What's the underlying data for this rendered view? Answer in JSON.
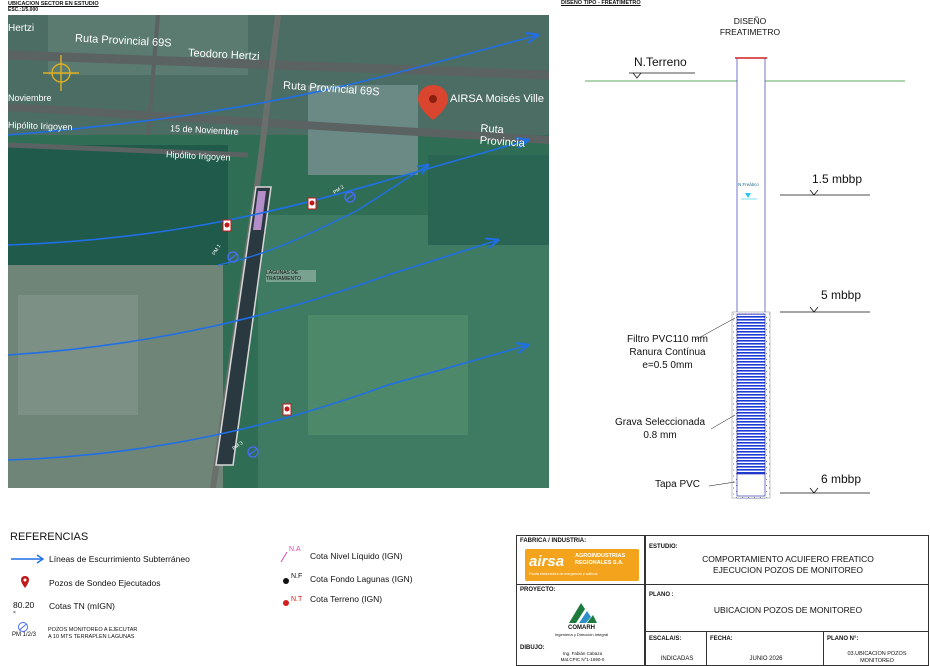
{
  "map": {
    "title": "UBICACION SECTOR EN ESTUDIO",
    "scale": "ESC.:1/5.000",
    "roads": {
      "rp69s_top": "Ruta Provincial 69S",
      "teodoro_top": "Teodoro Hertzi",
      "hertzi_left": "Hertzi",
      "rp69s_mid": "Ruta Provincial 69S",
      "noviembre_left": "Noviembre",
      "noviembre_mid": "15 de Noviembre",
      "irigoyen_left": "Hipólito Irigoyen",
      "irigoyen_mid": "Hipólito Irigoyen",
      "rp_right": "Ruta Provincia"
    },
    "place_label": "AIRSA Moisés Ville",
    "lagunas_label": "LAGUNAS DE TRATAMIENTO",
    "pm_labels": [
      "PM 1",
      "PM 2",
      "PM 3"
    ],
    "colors": {
      "flow": "#1e6fe8",
      "field": "#2f6e55",
      "road": "#5b6262"
    }
  },
  "section": {
    "title": "DISEÑO TIPO - FREATIMETRO",
    "heading_line1": "DISEÑO",
    "heading_line2": "FREATIMETRO",
    "ground": "N.Terreno",
    "freatico": "N.Freático",
    "level1": "1.5 mbbp",
    "level2": "5 mbbp",
    "level3": "6 mbbp",
    "filtro1": "Filtro PVC110 mm",
    "filtro2": "Ranura Contínua",
    "filtro3": "e=0.5 0mm",
    "grava1": "Grava Seleccionada",
    "grava2": "0.8 mm",
    "tapa": "Tapa PVC"
  },
  "references": {
    "title": "REFERENCIAS",
    "flow": "Líneas de Escurrimiento Subterráneo",
    "pozos": "Pozos de Sondeo Ejecutados",
    "cotas_num": "80.20",
    "cotas": "Cotas TN (mIGN)",
    "pm_symbol": "PM 1/2/3",
    "pm_line1": "POZOS MONITOREO A EJECUTAR",
    "pm_line2": "A 10 MTS TERRAPLEN LAGUNAS",
    "na_tag": "N.A",
    "na": "Cota Nivel Líquido (IGN)",
    "nf_tag": "N.F",
    "nf": "Cota Fondo Lagunas (IGN)",
    "nt_tag": "N.T",
    "nt": "Cota Terreno (IGN)"
  },
  "titleblock": {
    "fabrica_label": "FABRICA / INDUSTRIA:",
    "airsa_brand": "airsa",
    "airsa_name1": "AGROINDUSTRIAS",
    "airsa_name2": "REGIONALES S.A.",
    "airsa_tagline": "Planta elaboradora de margarinas y aditivos",
    "estudio_label": "ESTUDIO:",
    "estudio1": "COMPORTAMIENTO ACUIFERO FREATICO",
    "estudio2": "EJECUCION POZOS DE MONITOREO",
    "proyecto_label": "PROYECTO:",
    "comarh": "COMARH",
    "comarh_sub": "Ingeniería y Dirección Integral",
    "plano_label": "PLANO :",
    "plano": "UBICACION POZOS DE MONITOREO",
    "dibujo_label": "DIBUJO:",
    "dibujo1": "Ing. Fabián Cabaza",
    "dibujo2": "Mat.CPIC N°1-1690-0",
    "escala_label": "ESCALA/S:",
    "escala": "INDICADAS",
    "fecha_label": "FECHA:",
    "fecha": "JUNIO 2026",
    "plano_n_label": "PLANO N°:",
    "plano_n1": "03.UBICACION POZOS",
    "plano_n2": "MONITOREO"
  }
}
